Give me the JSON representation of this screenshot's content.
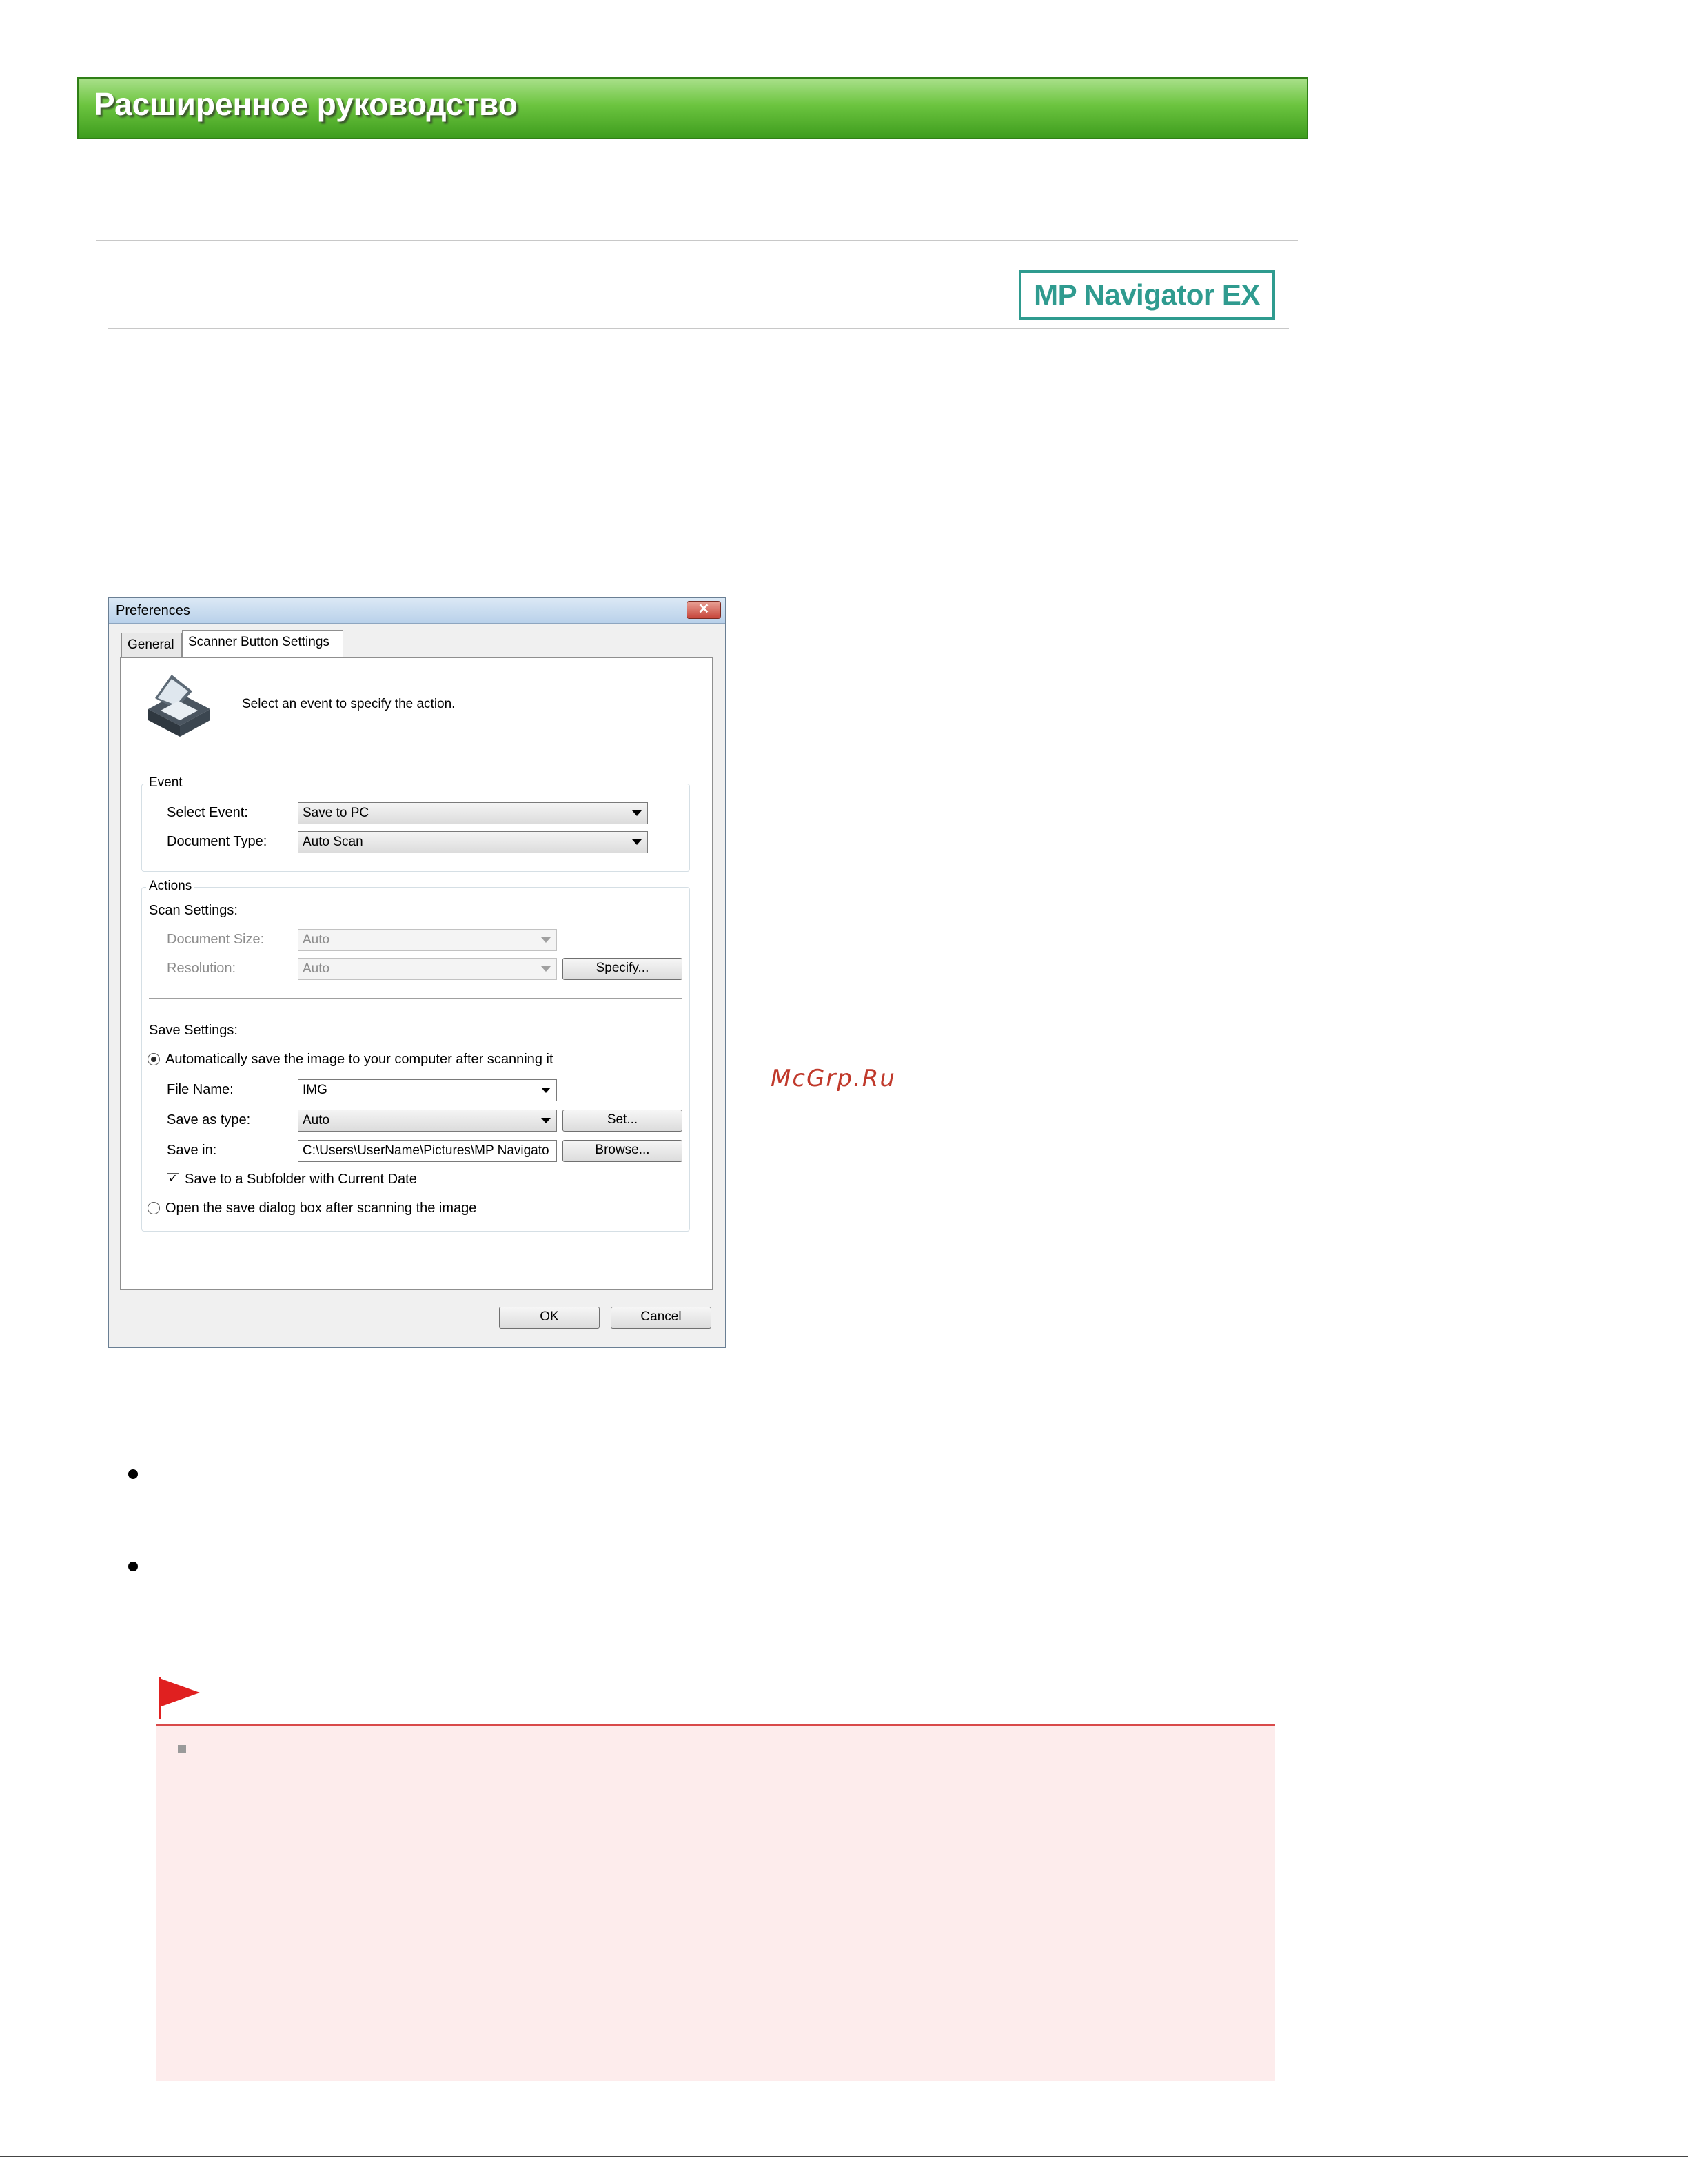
{
  "header": {
    "banner_title": "Расширенное руководство"
  },
  "logo": {
    "text": "MP Navigator EX"
  },
  "dialog": {
    "title": "Preferences",
    "close_glyph": "✕",
    "tabs": [
      {
        "label": "General",
        "active": false
      },
      {
        "label": "Scanner Button Settings",
        "active": true
      }
    ],
    "instruction": "Select an event to specify the action.",
    "event_group": {
      "label": "Event",
      "select_event_label": "Select Event:",
      "select_event_value": "Save to PC",
      "document_type_label": "Document Type:",
      "document_type_value": "Auto Scan"
    },
    "actions_group": {
      "label": "Actions",
      "scan_settings_label": "Scan Settings:",
      "document_size_label": "Document Size:",
      "document_size_value": "Auto",
      "resolution_label": "Resolution:",
      "resolution_value": "Auto",
      "specify_button": "Specify...",
      "save_settings_label": "Save Settings:",
      "auto_save_radio": "Automatically save the image to your computer after scanning it",
      "file_name_label": "File Name:",
      "file_name_value": "IMG",
      "save_as_type_label": "Save as type:",
      "save_as_type_value": "Auto",
      "set_button": "Set...",
      "save_in_label": "Save in:",
      "save_in_value": "C:\\Users\\UserName\\Pictures\\MP Navigato",
      "browse_button": "Browse...",
      "subfolder_checkbox": "Save to a Subfolder with Current Date",
      "subfolder_checked": true,
      "open_dialog_radio": "Open the save dialog box after scanning the image",
      "auto_save_selected": true
    },
    "ok_button": "OK",
    "cancel_button": "Cancel"
  },
  "watermark": "McGrp.Ru",
  "colors": {
    "banner_green": "#6cc43f",
    "logo_teal": "#2f9b8f",
    "note_background": "#fdecec",
    "note_rule": "#d94a4a",
    "flag_red": "#e02020"
  },
  "icons": [
    "scanner-icon",
    "flag-icon",
    "close-icon",
    "chevron-down-icon"
  ]
}
